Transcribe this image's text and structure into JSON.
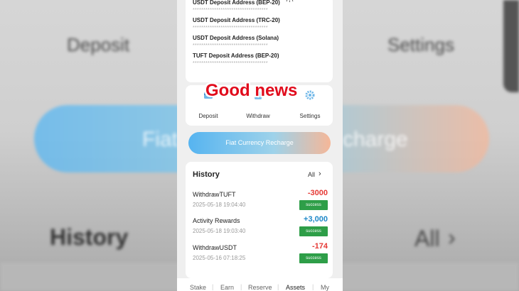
{
  "background": {
    "deposit": "Deposit",
    "settings": "Settings",
    "recharge_left": "Fiat",
    "recharge_right": "charge",
    "history": "History",
    "all": "All"
  },
  "addresses": [
    {
      "label": "USDT Deposit Address (BEP-20)",
      "masked": "***********************************"
    },
    {
      "label": "USDT Deposit Address (TRC-20)",
      "masked": "***********************************"
    },
    {
      "label": "USDT Deposit Address (Solana)",
      "masked": "***********************************"
    },
    {
      "label": "TUFT Deposit Address (BEP-20)",
      "masked": "***********************************"
    }
  ],
  "overlay_text": "Good news",
  "quick_actions": [
    {
      "label": "Deposit",
      "icon": "deposit-icon"
    },
    {
      "label": "Withdraw",
      "icon": "withdraw-icon"
    },
    {
      "label": "Settings",
      "icon": "gear-icon"
    }
  ],
  "recharge_button": "Fiat Currency Recharge",
  "history": {
    "title": "History",
    "all_label": "All",
    "items": [
      {
        "name": "WithdrawTUFT",
        "time": "2025-05-18 19:04:40",
        "amount": "-3000",
        "status": "success"
      },
      {
        "name": "Activity Rewards",
        "time": "2025-05-18 19:03:40",
        "amount": "+3,000",
        "status": "success"
      },
      {
        "name": "WithdrawUSDT",
        "time": "2025-05-16 07:18:25",
        "amount": "-174",
        "status": "success"
      }
    ]
  },
  "bottom_nav": [
    "Stake",
    "Earn",
    "Reserve",
    "Assets",
    "My"
  ],
  "colors": {
    "negative": "#e53935",
    "positive": "#1e88c8",
    "success_badge": "#2e9e48",
    "overlay_red": "#e10b1c"
  }
}
